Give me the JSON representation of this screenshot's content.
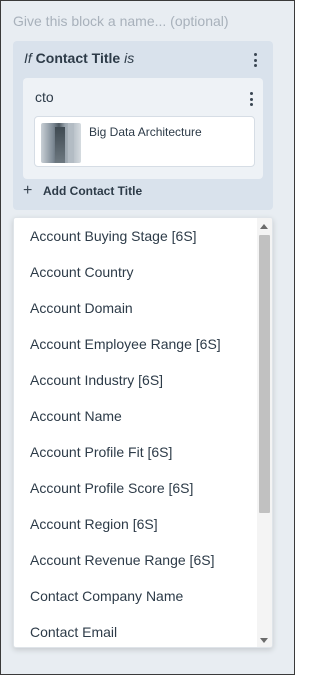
{
  "block_name_placeholder": "Give this block a name... (optional)",
  "condition": {
    "prefix": "If",
    "field": "Contact Title",
    "operator": "is",
    "value": "cto",
    "chip_label": "Big Data Architecture",
    "add_label": "Add Contact Title"
  },
  "dropdown": {
    "options": [
      "Account Buying Stage [6S]",
      "Account Country",
      "Account Domain",
      "Account Employee Range [6S]",
      "Account Industry [6S]",
      "Account Name",
      "Account Profile Fit [6S]",
      "Account Profile Score [6S]",
      "Account Region [6S]",
      "Account Revenue Range [6S]",
      "Contact Company Name",
      "Contact Email"
    ]
  }
}
